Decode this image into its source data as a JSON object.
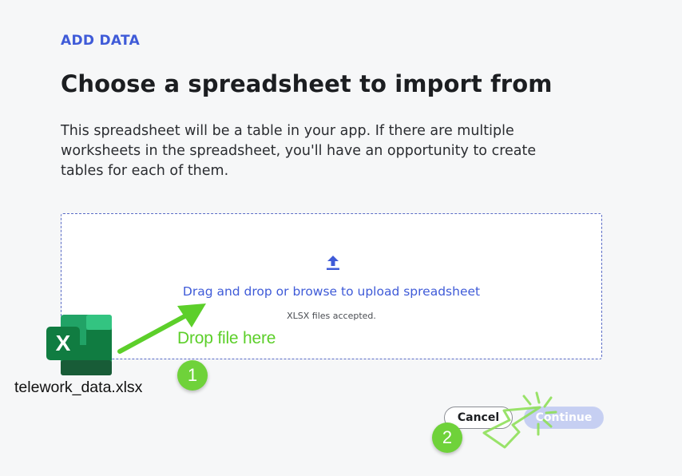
{
  "header": {
    "eyebrow": "ADD DATA",
    "title": "Choose a spreadsheet to import from",
    "description": "This spreadsheet will be a table in your app. If there are multiple worksheets in the spreadsheet, you'll have an opportunity to create tables for each of them."
  },
  "dropzone": {
    "icon": "upload-icon",
    "link_text": "Drag and drop or browse to upload spreadsheet",
    "accepted_note": "XLSX files accepted."
  },
  "file": {
    "icon": "excel-icon",
    "icon_letter": "X",
    "name": "telework_data.xlsx"
  },
  "annotations": {
    "drop_label": "Drop file here",
    "step_1": "1",
    "step_2": "2"
  },
  "buttons": {
    "cancel": "Cancel",
    "continue": "Continue"
  },
  "colors": {
    "accent_blue": "#3f5bd8",
    "annotation_green": "#5ccf2a",
    "badge_green": "#6fd23a",
    "excel_green": "#1f7a47",
    "continue_disabled": "#c6cff2"
  }
}
